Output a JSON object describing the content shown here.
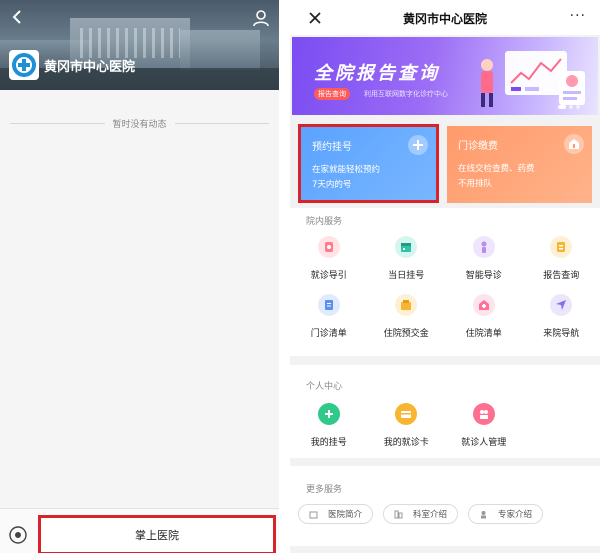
{
  "left_phone": {
    "hospital_name": "黄冈市中心医院",
    "empty_feed_text": "暂时没有动态",
    "bottom_menu_label": "掌上医院",
    "highlight_color": "#d8232a"
  },
  "right_phone": {
    "header": {
      "title": "黄冈市中心医院",
      "more_label": "···"
    },
    "banner": {
      "title": "全院报告查询",
      "tag": "报告查询",
      "subtitle": "利用互联网数字化诊疗中心",
      "colors": [
        "#7b4cf2",
        "#eae4ff"
      ]
    },
    "cards": [
      {
        "title": "预约挂号",
        "desc_line1": "在家就能轻松预约",
        "desc_line2": "7天内的号",
        "icon": "plus-icon",
        "color": "#5aa3ff"
      },
      {
        "title": "门诊缴费",
        "desc_line1": "在线交检查费、药费",
        "desc_line2": "不用排队",
        "icon": "house-icon",
        "color": "#ff9a6b"
      }
    ],
    "services": {
      "heading": "院内服务",
      "items": [
        {
          "label": "就诊导引",
          "icon": "guide-icon",
          "color": "#ff7a8a"
        },
        {
          "label": "当日挂号",
          "icon": "calendar-icon",
          "color": "#2fc3a6"
        },
        {
          "label": "智能导诊",
          "icon": "person-icon",
          "color": "#b78cf0"
        },
        {
          "label": "报告查询",
          "icon": "report-icon",
          "color": "#f7b531"
        },
        {
          "label": "门诊清单",
          "icon": "list-icon",
          "color": "#5b8ff2"
        },
        {
          "label": "住院预交金",
          "icon": "deposit-icon",
          "color": "#f7b531"
        },
        {
          "label": "住院清单",
          "icon": "ward-icon",
          "color": "#ff6f9a"
        },
        {
          "label": "来院导航",
          "icon": "navigate-icon",
          "color": "#8a6cf0"
        }
      ]
    },
    "personal": {
      "heading": "个人中心",
      "items": [
        {
          "label": "我的挂号",
          "icon": "my-reg-icon",
          "color": "#2fc98a"
        },
        {
          "label": "我的就诊卡",
          "icon": "card-icon",
          "color": "#f7b531"
        },
        {
          "label": "就诊人管理",
          "icon": "patients-icon",
          "color": "#ff6f8f"
        }
      ]
    },
    "more_services": {
      "heading": "更多服务",
      "items": [
        {
          "label": "医院简介",
          "icon": "hospital-icon"
        },
        {
          "label": "科室介绍",
          "icon": "department-icon"
        },
        {
          "label": "专家介绍",
          "icon": "expert-icon"
        }
      ]
    }
  }
}
